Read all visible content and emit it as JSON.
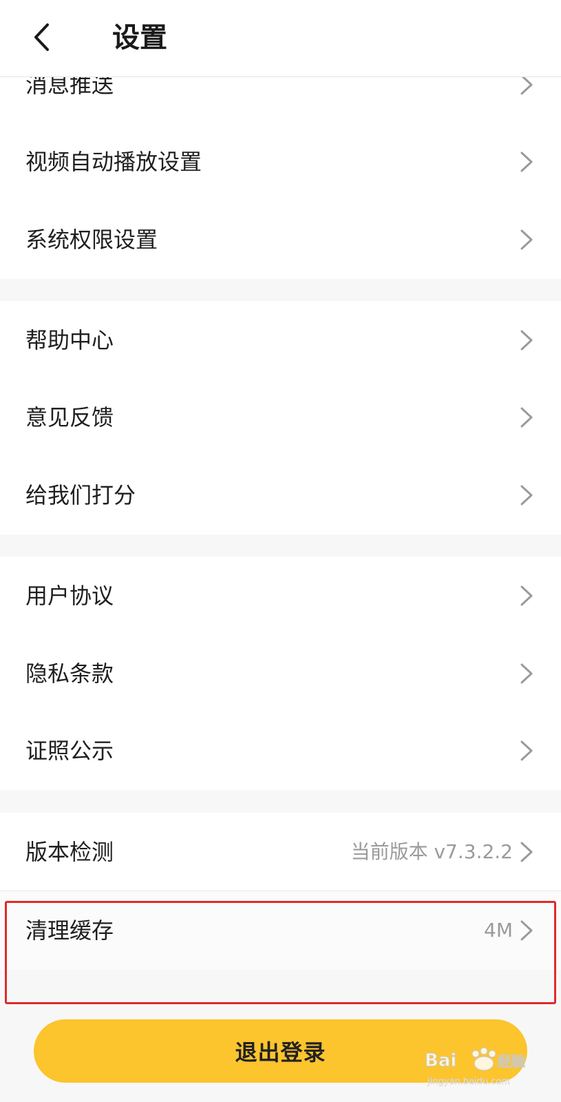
{
  "header": {
    "title": "设置",
    "back_icon": "chevron-left-icon"
  },
  "groups": [
    {
      "items": [
        {
          "label": "消息推送"
        },
        {
          "label": "视频自动播放设置"
        },
        {
          "label": "系统权限设置"
        }
      ]
    },
    {
      "items": [
        {
          "label": "帮助中心"
        },
        {
          "label": "意见反馈"
        },
        {
          "label": "给我们打分"
        }
      ]
    },
    {
      "items": [
        {
          "label": "用户协议"
        },
        {
          "label": "隐私条款"
        },
        {
          "label": "证照公示"
        }
      ]
    },
    {
      "items": [
        {
          "label": "版本检测",
          "value": "当前版本 v7.3.2.2"
        },
        {
          "label": "清理缓存",
          "value": "4M"
        }
      ]
    }
  ],
  "logout": {
    "label": "退出登录"
  },
  "watermark": {
    "brand": "Baidu经验",
    "url": "jingyan.baidu.com"
  },
  "colors": {
    "accent": "#fcc42d",
    "highlight": "#e02a2a",
    "background": "#f7f7f7",
    "row": "#ffffff"
  }
}
